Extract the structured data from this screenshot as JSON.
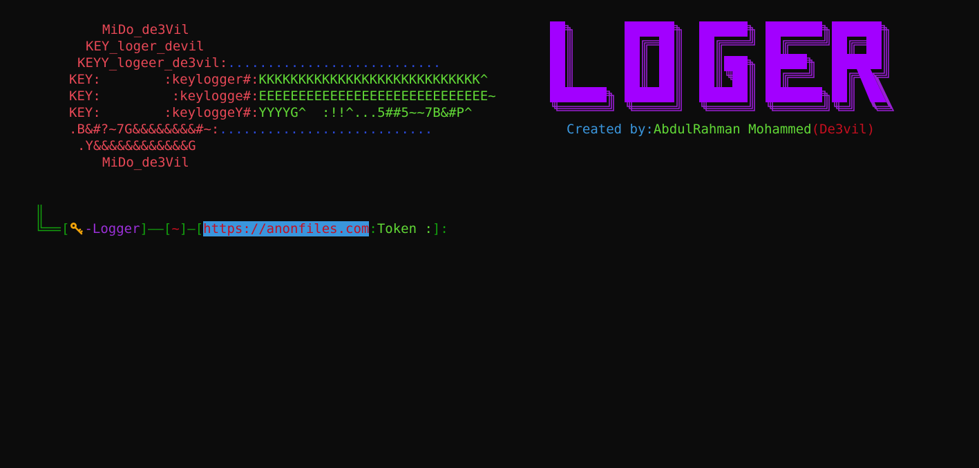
{
  "banner": {
    "lines": [
      "MiDo_de3Vil",
      "KEY_loger_devil",
      "KEYY_logeer_de3vil:",
      "...........................",
      "KEY:        :keylogger#:",
      "KKKKKKKKKKKKKKKKKKKKKKKKKKKK^",
      "KEY:         :keylogge#:",
      "EEEEEEEEEEEEEEEEEEEEEEEEEEEEE~",
      "KEY:        :keyloggeY#:",
      "YYYYG^  :!!^...5##5~~7B&#P^",
      ".B&#?~7G&&&&&&&&#~:",
      "...........................",
      ".Y&&&&&&&&&&&&G",
      "MiDo_de3Vil"
    ]
  },
  "logo": {
    "text": "LOGER",
    "color": "#a200ff"
  },
  "credits": {
    "label": "Created by:",
    "author": "AbdulRahman Mohammed",
    "alias": "(De3vil)"
  },
  "prompt": {
    "open1": "[",
    "key_icon": "key-icon",
    "tool": "-Logger",
    "close1": "]",
    "dash": "——",
    "open2": "[",
    "dir": "~",
    "close2": "]",
    "dash2": "—",
    "open3": "[",
    "url": "https://anonfiles.com",
    "colon": ":",
    "token_label": "Token :",
    "close3": "]:"
  }
}
